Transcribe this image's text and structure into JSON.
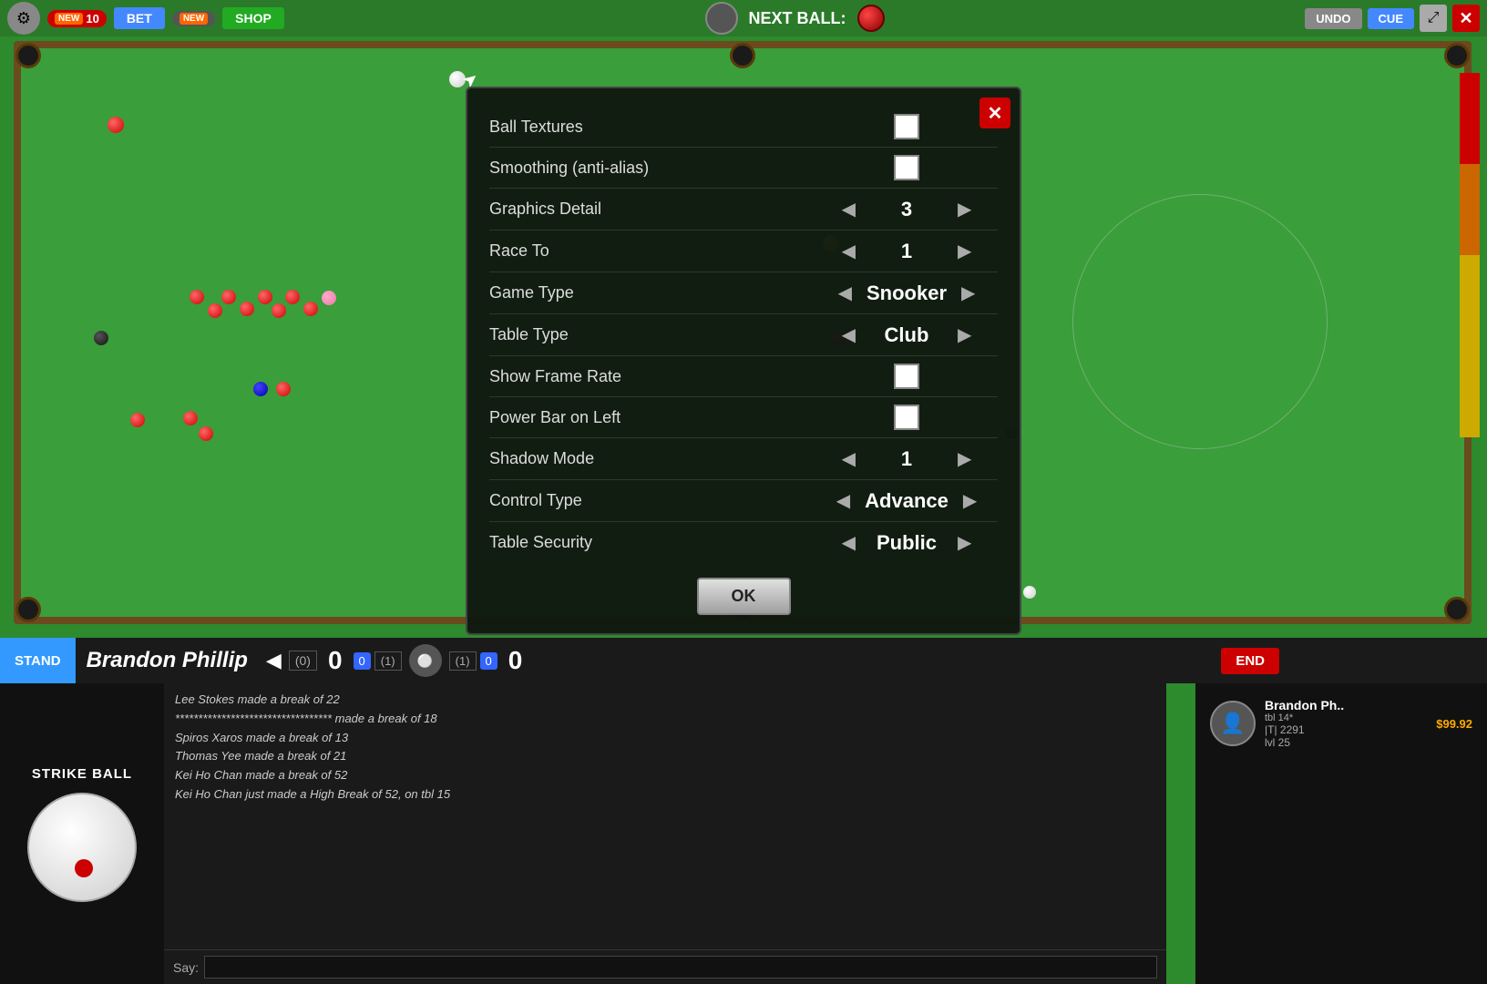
{
  "topbar": {
    "next_ball_label": "NEXT BALL:",
    "undo_label": "UNDO",
    "cue_label": "CUE"
  },
  "modal": {
    "title": "Settings",
    "close_label": "✕",
    "rows": [
      {
        "label": "Ball Textures",
        "type": "checkbox",
        "checked": false
      },
      {
        "label": "Smoothing (anti-alias)",
        "type": "checkbox_checked",
        "checked": true
      },
      {
        "label": "Graphics Detail",
        "type": "stepper",
        "value": "3"
      },
      {
        "label": "Race To",
        "type": "stepper",
        "value": "1"
      },
      {
        "label": "Game Type",
        "type": "selector",
        "value": "Snooker"
      },
      {
        "label": "Table Type",
        "type": "selector",
        "value": "Club"
      },
      {
        "label": "Show Frame Rate",
        "type": "checkbox",
        "checked": false
      },
      {
        "label": "Power Bar on Left",
        "type": "checkbox",
        "checked": false
      },
      {
        "label": "Shadow Mode",
        "type": "stepper",
        "value": "1"
      },
      {
        "label": "Control Type",
        "type": "selector",
        "value": "Advance"
      },
      {
        "label": "Table Security",
        "type": "selector",
        "value": "Public"
      }
    ],
    "ok_label": "OK"
  },
  "bottombar": {
    "stand_label": "STAND",
    "player_name": "Brandon  Phillip",
    "score_left_parens": "(0)",
    "score_left": "0",
    "score_left_badge": "0",
    "score_frame_left": "(1)",
    "score_right_badge": "(1)",
    "score_right": "0",
    "score_right_main": "0",
    "end_label": "END"
  },
  "chat": {
    "say_label": "Say:",
    "messages": [
      "Lee Stokes made a break of 22",
      "********************************** made a break of 18",
      "Spiros Xaros made a break of 13",
      "Thomas Yee made a break of 21",
      "Kei Ho Chan made a break of 52",
      "Kei Ho Chan just made a High Break of 52, on tbl 15"
    ]
  },
  "cue_ball": {
    "label": "STRIKE BALL"
  },
  "player_panel": {
    "name": "Brandon Ph..",
    "tbl": "tbl 14*",
    "tier": "|T| 2291",
    "level": "lvl 25",
    "money": "$99.92"
  }
}
